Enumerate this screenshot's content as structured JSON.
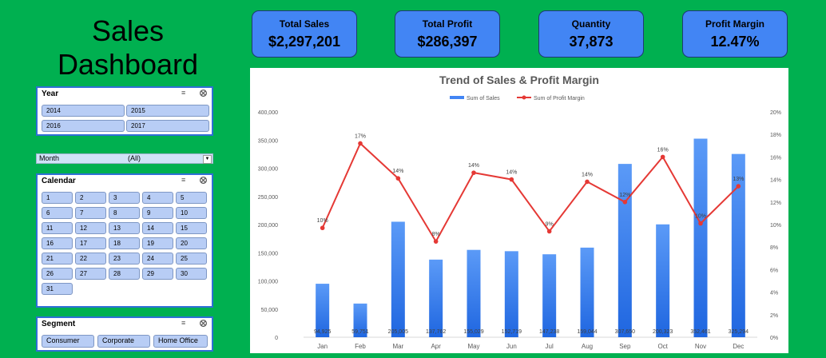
{
  "title_line1": "Sales",
  "title_line2": "Dashboard",
  "kpis": [
    {
      "label": "Total Sales",
      "value": "$2,297,201"
    },
    {
      "label": "Total Profit",
      "value": "$286,397"
    },
    {
      "label": "Quantity",
      "value": "37,873"
    },
    {
      "label": "Profit Margin",
      "value": "12.47%"
    }
  ],
  "year_slicer": {
    "title": "Year",
    "items": [
      "2014",
      "2015",
      "2016",
      "2017"
    ]
  },
  "month_filter": {
    "label": "Month",
    "value": "(All)"
  },
  "calendar_slicer": {
    "title": "Calendar",
    "items": [
      "1",
      "2",
      "3",
      "4",
      "5",
      "6",
      "7",
      "8",
      "9",
      "10",
      "11",
      "12",
      "13",
      "14",
      "15",
      "16",
      "17",
      "18",
      "19",
      "20",
      "21",
      "22",
      "23",
      "24",
      "25",
      "26",
      "27",
      "28",
      "29",
      "30",
      "31"
    ]
  },
  "segment_slicer": {
    "title": "Segment",
    "items": [
      "Consumer",
      "Corporate",
      "Home Office"
    ]
  },
  "colors": {
    "background": "#00b050",
    "accent": "#4285f4",
    "line": "#e53935"
  },
  "chart_data": {
    "type": "bar",
    "title": "Trend of Sales & Profit Margin",
    "categories": [
      "Jan",
      "Feb",
      "Mar",
      "Apr",
      "May",
      "Jun",
      "Jul",
      "Aug",
      "Sep",
      "Oct",
      "Nov",
      "Dec"
    ],
    "series": [
      {
        "name": "Sum of Sales",
        "type": "bar",
        "axis": "left",
        "values": [
          94925,
          59751,
          205005,
          137762,
          155029,
          152719,
          147238,
          159044,
          307650,
          200323,
          352461,
          325294
        ],
        "labels": [
          "94,925",
          "59,751",
          "205,005",
          "137,762",
          "155,029",
          "152,719",
          "147,238",
          "159,044",
          "307,650",
          "200,323",
          "352,461",
          "325,294"
        ]
      },
      {
        "name": "Sum of Profit Margin",
        "type": "line",
        "axis": "right",
        "values": [
          0.097,
          0.172,
          0.141,
          0.085,
          0.146,
          0.14,
          0.094,
          0.138,
          0.12,
          0.16,
          0.101,
          0.134
        ],
        "labels": [
          "10%",
          "17%",
          "14%",
          "8%",
          "14%",
          "14%",
          "9%",
          "14%",
          "12%",
          "16%",
          "10%",
          "13%"
        ]
      }
    ],
    "ylim_left": [
      0,
      400000
    ],
    "ylim_right": [
      0,
      0.2
    ],
    "left_ticks": [
      "0",
      "50,000",
      "100,000",
      "150,000",
      "200,000",
      "250,000",
      "300,000",
      "350,000",
      "400,000"
    ],
    "right_ticks": [
      "0%",
      "2%",
      "4%",
      "6%",
      "8%",
      "10%",
      "12%",
      "14%",
      "16%",
      "18%",
      "20%"
    ],
    "legend": "top",
    "grid": false
  }
}
